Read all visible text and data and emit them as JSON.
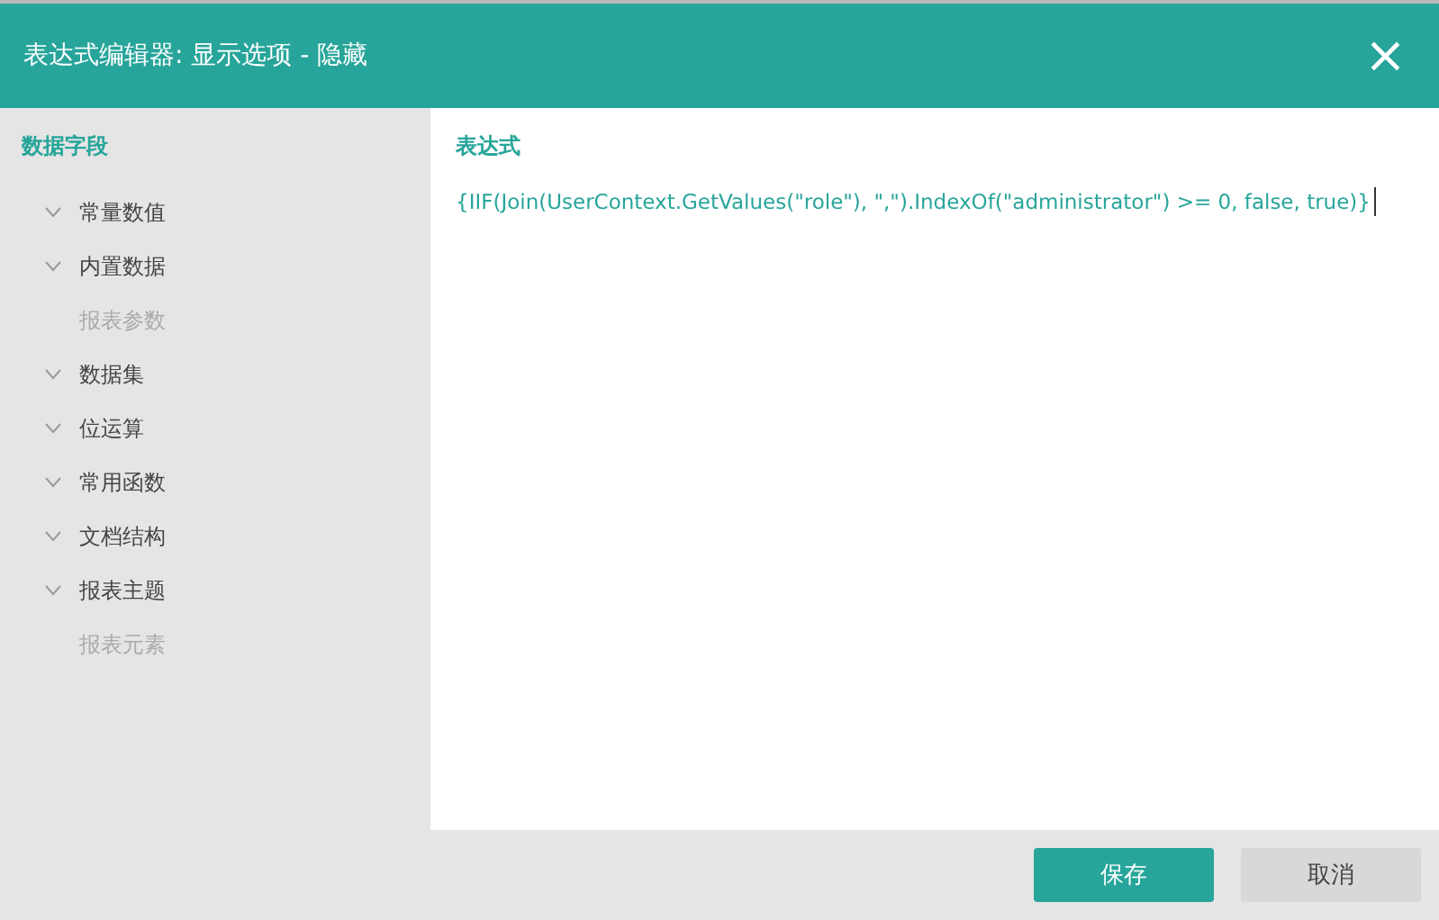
{
  "window": {
    "title": "表达式编辑器: 显示选项 - 隐藏",
    "close": "×"
  },
  "sidebar": {
    "title": "数据字段",
    "items": [
      {
        "label": "常量数值",
        "kind": "group",
        "disabled": false
      },
      {
        "label": "内置数据",
        "kind": "group",
        "disabled": false
      },
      {
        "label": "报表参数",
        "kind": "leaf",
        "disabled": true
      },
      {
        "label": "数据集",
        "kind": "group",
        "disabled": false
      },
      {
        "label": "位运算",
        "kind": "group",
        "disabled": false
      },
      {
        "label": "常用函数",
        "kind": "group",
        "disabled": false
      },
      {
        "label": "文档结构",
        "kind": "group",
        "disabled": false
      },
      {
        "label": "报表主题",
        "kind": "group",
        "disabled": false
      },
      {
        "label": "报表元素",
        "kind": "leaf",
        "disabled": true
      }
    ]
  },
  "editor": {
    "title": "表达式",
    "value": "{IIF(Join(UserContext.GetValues(\"role\"), \",\").IndexOf(\"administrator\") >= 0, false, true)}"
  },
  "buttons": [
    {
      "label": "保存",
      "kind": "primary"
    },
    {
      "label": "取消",
      "kind": "secondary"
    }
  ]
}
